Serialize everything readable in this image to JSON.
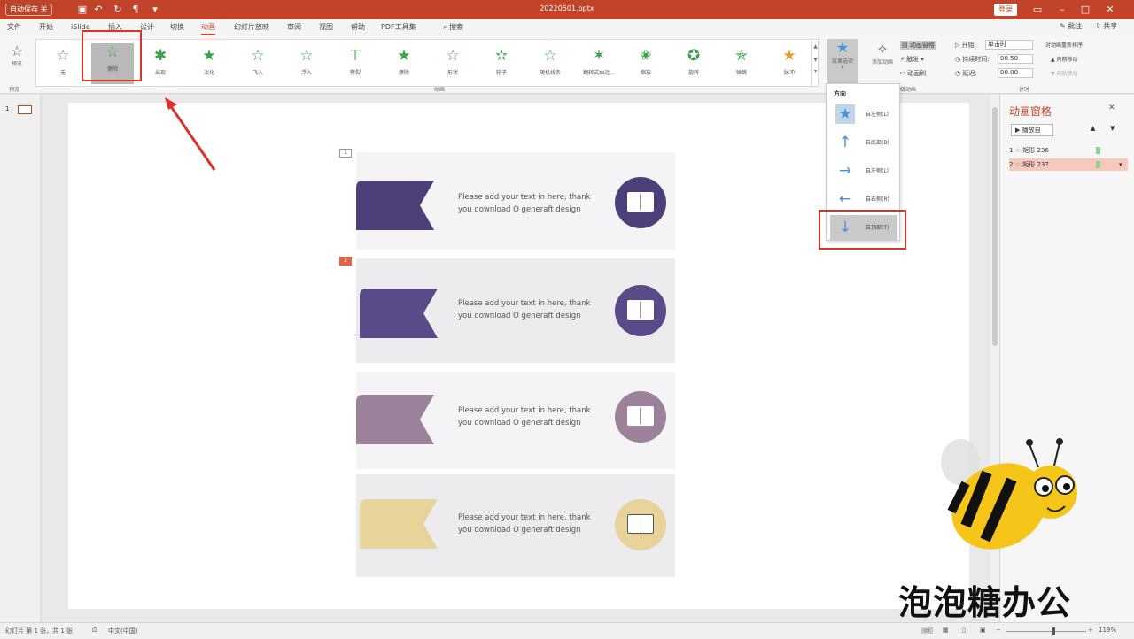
{
  "titlebar": {
    "autosave_label": "自动保存",
    "autosave_state": "关",
    "document_title": "20220501.pptx",
    "login_label": "登录"
  },
  "menu": {
    "items": [
      "文件",
      "开始",
      "iSlide",
      "插入",
      "设计",
      "切换",
      "动画",
      "幻灯片放映",
      "审阅",
      "视图",
      "帮助",
      "PDF工具集"
    ],
    "active": "动画",
    "search": "搜索",
    "comments": "批注",
    "share": "共享"
  },
  "ribbon": {
    "preview_label": "预览",
    "preview_group": "预览",
    "animation_group": "动画",
    "gallery": [
      {
        "label": "无",
        "color": "#7f7f9a"
      },
      {
        "label": "擦除",
        "color": "#3aa348"
      },
      {
        "label": "出现",
        "color": "#3aa348"
      },
      {
        "label": "淡化",
        "color": "#3aa348"
      },
      {
        "label": "飞入",
        "color": "#3aa348"
      },
      {
        "label": "浮入",
        "color": "#3aa348"
      },
      {
        "label": "劈裂",
        "color": "#3aa348"
      },
      {
        "label": "擦除",
        "color": "#3aa348"
      },
      {
        "label": "形状",
        "color": "#3aa348"
      },
      {
        "label": "轮子",
        "color": "#3aa348"
      },
      {
        "label": "随机线条",
        "color": "#3aa348"
      },
      {
        "label": "翻转式由远...",
        "color": "#3aa348"
      },
      {
        "label": "缩放",
        "color": "#3aa348"
      },
      {
        "label": "旋转",
        "color": "#3aa348"
      },
      {
        "label": "弹跳",
        "color": "#3aa348"
      },
      {
        "label": "脉冲",
        "color": "#e3a32b"
      }
    ],
    "effect_options_label": "效果选项",
    "add_animation_label": "添加动画",
    "animation_pane_label": "动画窗格",
    "trigger_label": "触发",
    "painter_label": "动画刷",
    "advanced_group": "高级动画",
    "start_label": "开始:",
    "start_value": "单击时",
    "duration_label": "持续时间:",
    "duration_value": "00.50",
    "delay_label": "延迟:",
    "delay_value": "00.00",
    "reorder_title": "对动画重新排序",
    "move_earlier": "向前移动",
    "move_later": "向后移动",
    "timing_group": "计时"
  },
  "dropdown": {
    "header": "方向",
    "items": [
      {
        "icon": "★",
        "label": "自左侧(L)"
      },
      {
        "icon": "↑",
        "label": "自底部(B)"
      },
      {
        "icon": "→",
        "label": "自左侧(L)"
      },
      {
        "icon": "←",
        "label": "自右侧(R)"
      },
      {
        "icon": "↓",
        "label": "自顶部(T)"
      }
    ]
  },
  "slide": {
    "thumb_number": "1",
    "anim_tag_1": "1",
    "anim_tag_2": "2",
    "items": [
      {
        "text_line1": "Please add your text in here, thank",
        "text_line2": "you download O generaft design",
        "color": "#4d3f78"
      },
      {
        "text_line1": "Please add your text in here, thank",
        "text_line2": "you download O generaft design",
        "color": "#5a4a88"
      },
      {
        "text_line1": "Please add your text in here, thank",
        "text_line2": "you download O generaft design",
        "color": "#9b8199"
      },
      {
        "text_line1": "Please add your text in here, thank",
        "text_line2": "you download O generaft design",
        "color": "#e8d49a"
      }
    ]
  },
  "anipane": {
    "title": "动画窗格",
    "play_label": "播放自",
    "rows": [
      {
        "num": "1",
        "label": "矩形 236"
      },
      {
        "num": "2",
        "label": "矩形 237"
      }
    ]
  },
  "status": {
    "slide_info": "幻灯片 第 1 张，共 1 张",
    "language": "中文(中国)",
    "zoom": "119%"
  },
  "watermark": "泡泡糖办公"
}
